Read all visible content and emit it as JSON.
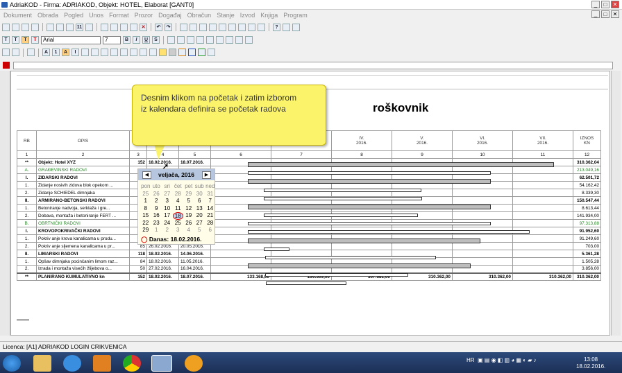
{
  "window": {
    "title": "AdriaKOD - Firma: ADRIAKOD,  Objekt: HOTEL, Elaborat [GANT0]"
  },
  "menu": [
    "Dokument",
    "Obrada",
    "Pogled",
    "Unos",
    "Format",
    "Prozor",
    "Događaj",
    "Obračun",
    "Stanje",
    "Izvod",
    "Knjiga",
    "Program"
  ],
  "format_toolbar": {
    "font": "Arial",
    "size": "7"
  },
  "callout": {
    "line1": "Desnim klikom na početak i zatim izborom",
    "line2": "iz kalendara definira se početak radova"
  },
  "heading": "roškovnik",
  "table": {
    "headers": [
      "RB",
      "OPIS",
      "3",
      "4",
      "5",
      "",
      "",
      "IV.\n2016.",
      "V.\n2016.",
      "VI.\n2016.",
      "VII.\n2016.",
      "IZNOS\nKN"
    ],
    "col_numbers": [
      "1",
      "2",
      "3",
      "4",
      "5",
      "6",
      "7",
      "8",
      "9",
      "10",
      "11",
      "12"
    ],
    "rows": [
      {
        "rb": "**",
        "opis": "Objekt: Hotel XYZ",
        "c3": "152",
        "c4": "18.02.2016.",
        "c5": "18.07.2016.",
        "iznos": "310.362,04",
        "style": "b"
      },
      {
        "rb": "A.",
        "opis": "GRAĐEVINSKI RADOVI",
        "c3": "",
        "c4": "",
        "c5": "",
        "iznos": "213.049,16",
        "style": "g"
      },
      {
        "rb": "I.",
        "opis": "ZIDARSKI RADOVI",
        "c3": "",
        "c4": "",
        "c5": "",
        "iznos": "62.501,72",
        "style": "b"
      },
      {
        "rb": "1.",
        "opis": "Zidanje nosivih zidova blok opekom ...",
        "c3": "",
        "c4": "",
        "c5": "",
        "iznos": "54.162,42",
        "style": ""
      },
      {
        "rb": "2.",
        "opis": "Zidanje SCHIEDEL dimnjaka",
        "c3": "",
        "c4": "",
        "c5": "",
        "iznos": "8.339,30",
        "style": ""
      },
      {
        "rb": "II.",
        "opis": "ARMIRANO-BETONSKI RADOVI",
        "c3": "",
        "c4": "",
        "c5": "",
        "iznos": "150.547,44",
        "style": "b"
      },
      {
        "rb": "1.",
        "opis": "Betoniranje nadvoja, serklaža i gre...",
        "c3": "",
        "c4": "",
        "c5": "",
        "iznos": "8.613,44",
        "style": ""
      },
      {
        "rb": "2.",
        "opis": "Dobava, montaža i betoniranje FERT ...",
        "c3": "",
        "c4": "",
        "c5": "",
        "iznos": "141.934,00",
        "style": ""
      },
      {
        "rb": "B.",
        "opis": "OBRTNIČKI RADOVI",
        "c3": "",
        "c4": "",
        "c5": "",
        "iznos": "97.313,88",
        "style": "g"
      },
      {
        "rb": "I.",
        "opis": "KROVOPOKRIVAČKI RADOVI",
        "c3": "127",
        "c4": "18.02.2016.",
        "c5": "23.06.2016.",
        "iznos": "91.952,60",
        "style": "b"
      },
      {
        "rb": "1.",
        "opis": "Pokriv anje krova kanalicama u produ...",
        "c3": "19",
        "c4": "18.02.2016.",
        "c5": "07.03.2016.",
        "iznos": "91.249,60",
        "style": ""
      },
      {
        "rb": "2.",
        "opis": "Pokriv anje sljemena kanalicama u pr...",
        "c3": "85",
        "c4": "26.02.2016.",
        "c5": "20.05.2016.",
        "iznos": "703,00",
        "style": ""
      },
      {
        "rb": "II.",
        "opis": "LIMARSKI RADOVI",
        "c3": "118",
        "c4": "18.02.2016.",
        "c5": "14.06.2016.",
        "iznos": "5.361,28",
        "style": "b"
      },
      {
        "rb": "1.",
        "opis": "Opšav  dimnjaka pocinčanim limom raz...",
        "c3": "84",
        "c4": "18.02.2016.",
        "c5": "11.05.2016.",
        "iznos": "1.505,28",
        "style": ""
      },
      {
        "rb": "2.",
        "opis": "Izrada i montaža visećih žlijebova o...",
        "c3": "50",
        "c4": "27.02.2016.",
        "c5": "16.04.2016.",
        "iznos": "3.856,00",
        "style": ""
      }
    ],
    "footer": {
      "rb": "**",
      "opis": "PLANIRANO KUMULATIVNO kn",
      "c3": "152",
      "c4": "18.02.2016.",
      "c5": "18.07.2016.",
      "v6": "133.168,00",
      "v7": "290.309,00",
      "v8": "307.681,00",
      "v9": "310.362,00",
      "v10": "310.362,00",
      "v11": "310.362,00",
      "v12": "310.362,00"
    }
  },
  "calendar": {
    "month": "veljača, 2016",
    "days_header": [
      "pon",
      "uto",
      "sri",
      "čet",
      "pet",
      "sub",
      "ned"
    ],
    "weeks": [
      [
        "25",
        "26",
        "27",
        "28",
        "29",
        "30",
        "31"
      ],
      [
        "1",
        "2",
        "3",
        "4",
        "5",
        "6",
        "7"
      ],
      [
        "8",
        "9",
        "10",
        "11",
        "12",
        "13",
        "14"
      ],
      [
        "15",
        "16",
        "17",
        "18",
        "19",
        "20",
        "21"
      ],
      [
        "22",
        "23",
        "24",
        "25",
        "26",
        "27",
        "28"
      ],
      [
        "29",
        "1",
        "2",
        "3",
        "4",
        "5",
        "6"
      ]
    ],
    "today": "18",
    "footer": "Danas: 18.02.2016."
  },
  "status": "Licenca: [A1] ADRIAKOD LOGIN CRIKVENICA",
  "taskbar": {
    "lang": "HR",
    "time": "13:08",
    "date": "18.02.2016."
  }
}
